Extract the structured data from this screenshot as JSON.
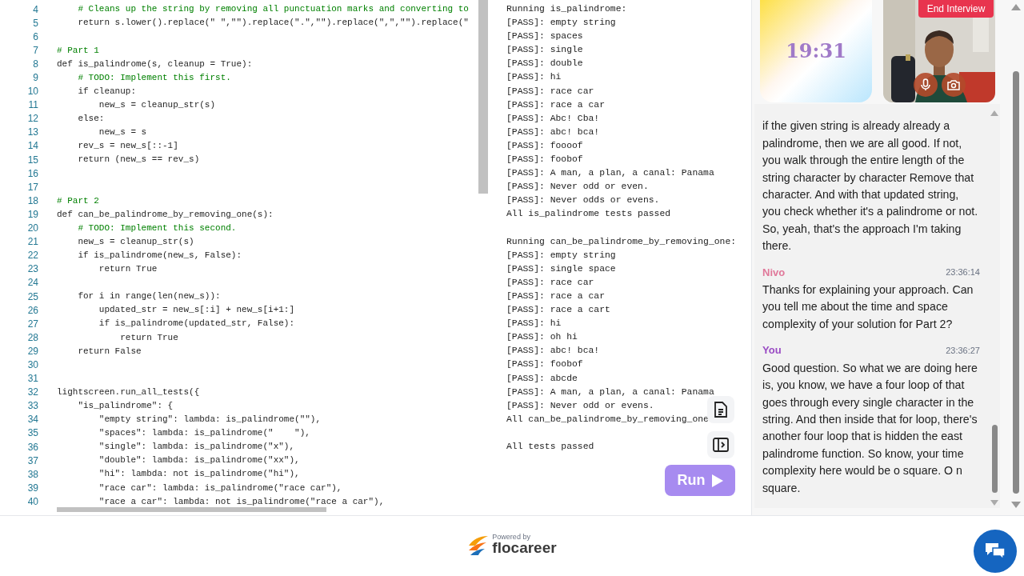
{
  "editor": {
    "lines": [
      {
        "number": "4",
        "kind": "comment",
        "text": "    # Cleans up the string by removing all punctuation marks and converting to"
      },
      {
        "number": "5",
        "kind": "code",
        "text": "    return s.lower().replace(\" \",\"\").replace(\".\",\"\").replace(\",\",\"\").replace(\""
      },
      {
        "number": "6"
      },
      {
        "number": "7",
        "kind": "comment",
        "text": "# Part 1"
      },
      {
        "number": "8",
        "kind": "code",
        "text": "def is_palindrome(s, cleanup = True):"
      },
      {
        "number": "9",
        "kind": "comment",
        "text": "    # TODO: Implement this first."
      },
      {
        "number": "10",
        "kind": "code",
        "text": "    if cleanup:"
      },
      {
        "number": "11",
        "kind": "code",
        "text": "        new_s = cleanup_str(s)"
      },
      {
        "number": "12",
        "kind": "code",
        "text": "    else:"
      },
      {
        "number": "13",
        "kind": "code",
        "text": "        new_s = s"
      },
      {
        "number": "14",
        "kind": "code",
        "text": "    rev_s = new_s[::-1]"
      },
      {
        "number": "15",
        "kind": "code",
        "text": "    return (new_s == rev_s)"
      },
      {
        "number": "16"
      },
      {
        "number": "17"
      },
      {
        "number": "18",
        "kind": "comment",
        "text": "# Part 2"
      },
      {
        "number": "19",
        "kind": "code",
        "text": "def can_be_palindrome_by_removing_one(s):"
      },
      {
        "number": "20",
        "kind": "comment",
        "text": "    # TODO: Implement this second."
      },
      {
        "number": "21",
        "kind": "code",
        "text": "    new_s = cleanup_str(s)"
      },
      {
        "number": "22",
        "kind": "code",
        "text": "    if is_palindrome(new_s, False):"
      },
      {
        "number": "23",
        "kind": "code",
        "text": "        return True"
      },
      {
        "number": "24"
      },
      {
        "number": "25",
        "kind": "code",
        "text": "    for i in range(len(new_s)):"
      },
      {
        "number": "26",
        "kind": "code",
        "text": "        updated_str = new_s[:i] + new_s[i+1:]"
      },
      {
        "number": "27",
        "kind": "code",
        "text": "        if is_palindrome(updated_str, False):"
      },
      {
        "number": "28",
        "kind": "code",
        "text": "            return True"
      },
      {
        "number": "29",
        "kind": "code",
        "text": "    return False"
      },
      {
        "number": "30"
      },
      {
        "number": "31"
      },
      {
        "number": "32",
        "kind": "code",
        "text": "lightscreen.run_all_tests({"
      },
      {
        "number": "33",
        "kind": "code",
        "text": "    \"is_palindrome\": {"
      },
      {
        "number": "34",
        "kind": "code",
        "text": "        \"empty string\": lambda: is_palindrome(\"\"),"
      },
      {
        "number": "35",
        "kind": "code",
        "text": "        \"spaces\": lambda: is_palindrome(\"    \"),"
      },
      {
        "number": "36",
        "kind": "code",
        "text": "        \"single\": lambda: is_palindrome(\"x\"),"
      },
      {
        "number": "37",
        "kind": "code",
        "text": "        \"double\": lambda: is_palindrome(\"xx\"),"
      },
      {
        "number": "38",
        "kind": "code",
        "text": "        \"hi\": lambda: not is_palindrome(\"hi\"),"
      },
      {
        "number": "39",
        "kind": "code",
        "text": "        \"race car\": lambda: is_palindrome(\"race car\"),"
      },
      {
        "number": "40",
        "kind": "code",
        "text": "        \"race a car\": lambda: not is_palindrome(\"race a car\"),"
      }
    ]
  },
  "output": {
    "groups": [
      [
        "Running is_palindrome:",
        "[PASS]: empty string",
        "[PASS]: spaces",
        "[PASS]: single",
        "[PASS]: double",
        "[PASS]: hi",
        "[PASS]: race car",
        "[PASS]: race a car",
        "[PASS]: Abc! Cba!",
        "[PASS]: abc! bca!",
        "[PASS]: foooof",
        "[PASS]: foobof",
        "[PASS]: A man, a plan, a canal: Panama",
        "[PASS]: Never odd or even.",
        "[PASS]: Never odds or evens.",
        "All is_palindrome tests passed"
      ],
      [
        "Running can_be_palindrome_by_removing_one:",
        "[PASS]: empty string",
        "[PASS]: single space",
        "[PASS]: race car",
        "[PASS]: race a car",
        "[PASS]: race a cart",
        "[PASS]: hi",
        "[PASS]: oh hi",
        "[PASS]: abc! bca!",
        "[PASS]: foobof",
        "[PASS]: abcde",
        "[PASS]: A man, a plan, a canal: Panama",
        "[PASS]: Never odd or evens.",
        "All can_be_palindrome_by_removing_one"
      ],
      [
        "All tests passed"
      ]
    ],
    "run_button": "Run"
  },
  "timer": "19:31",
  "end_button": "End Interview",
  "chat": [
    {
      "text": "if the given string is already already a palindrome, then we are all good. If not, you walk through the entire length of the string character by character Remove that character. And with that updated string, you check whether it's a palindrome or not. So, yeah, that's the approach I'm taking there."
    },
    {
      "kind": "interviewer",
      "author": "Nivo",
      "time": "23:36:14",
      "text": "Thanks for explaining your approach. Can you tell me about the time and space complexity of your solution for Part 2?"
    },
    {
      "kind": "candidate",
      "author": "You",
      "time": "23:36:27",
      "text": "Good question. So what we are doing here is, you know, we have a four loop of that goes through every single character in the string. And then inside that for loop, there's another four loop that is hidden the east palindrome function. So know, your time complexity here would be o square. O n square."
    }
  ],
  "footer": {
    "powered_by": "Powered by",
    "brand": "flocareer"
  }
}
